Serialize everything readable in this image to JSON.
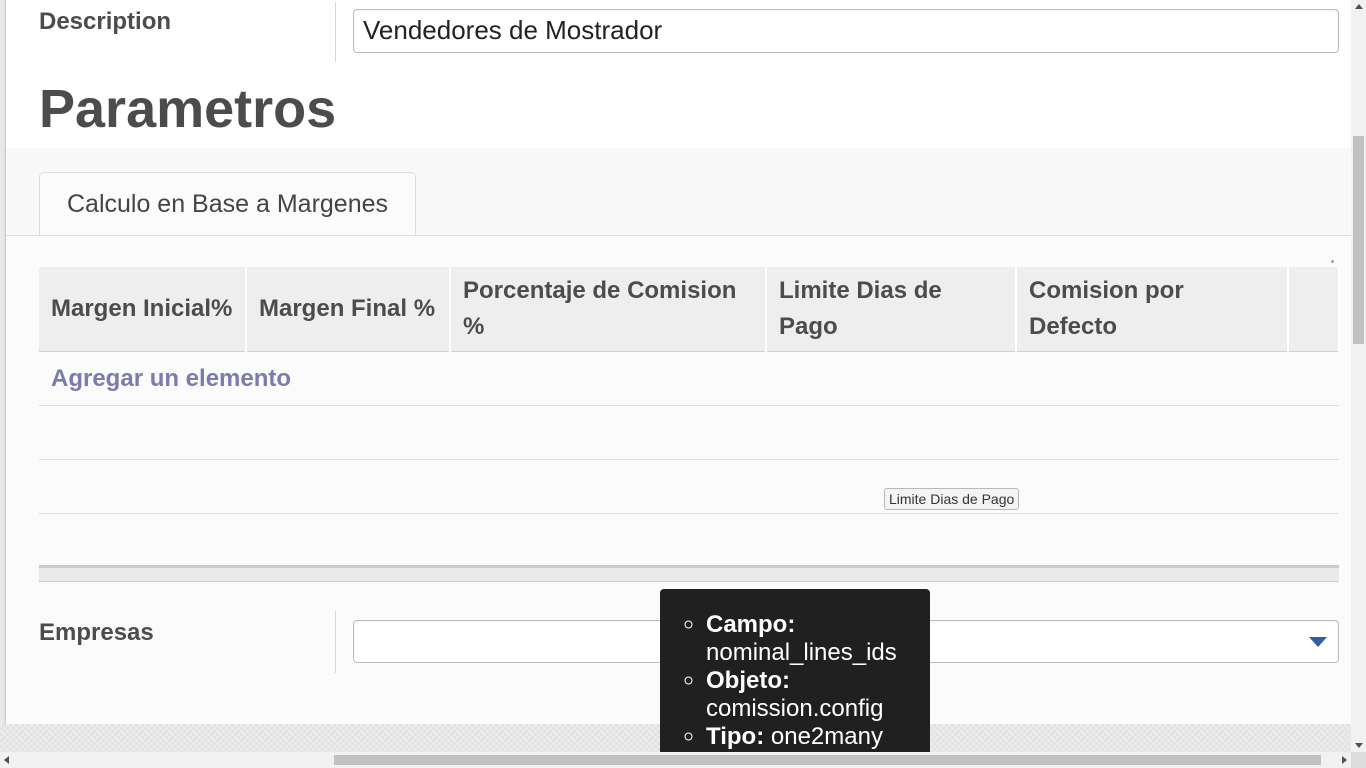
{
  "form": {
    "description_label": "Description",
    "description_value": "Vendedores de Mostrador",
    "section_title": "Parametros",
    "empresas_label": "Empresas",
    "empresas_value": ""
  },
  "notebook": {
    "tabs": [
      {
        "label": "Calculo en Base a Margenes",
        "active": true
      }
    ]
  },
  "grid": {
    "columns": [
      "Margen Inicial%",
      "Margen Final %",
      "Porcentaje de Comision %",
      "Limite Dias de Pago",
      "Comision por Defecto",
      ""
    ],
    "add_item_label": "Agregar un elemento",
    "empty_rows": 3
  },
  "tooltip": {
    "column_hint": "Limite Dias de Pago",
    "items": [
      {
        "key": "Campo:",
        "value": "nominal_lines_ids"
      },
      {
        "key": "Objeto:",
        "value": "comission.config"
      },
      {
        "key": "Tipo:",
        "value": "one2many"
      }
    ]
  },
  "colors": {
    "link": "#7c7bad",
    "tooltip_bg": "#202020",
    "dropdown_arrow": "#2f5fa6"
  }
}
